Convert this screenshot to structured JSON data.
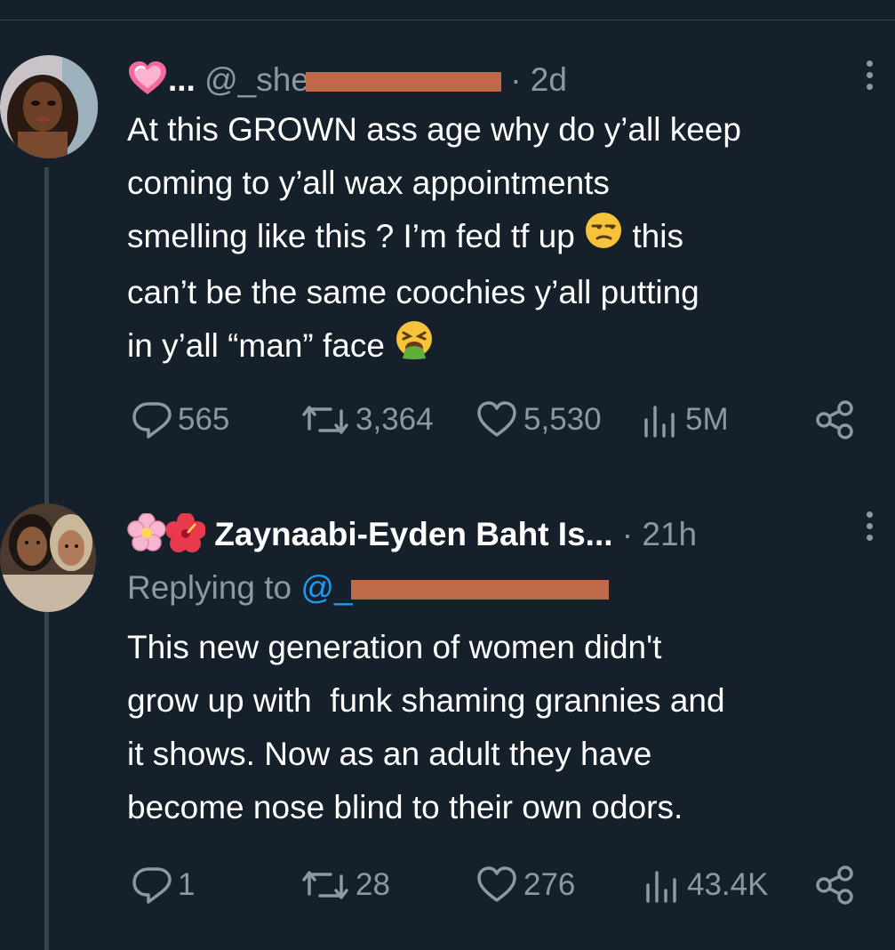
{
  "tweet1": {
    "display_name_suffix": "...",
    "handle": "@_she",
    "time": "· 2d",
    "text_lines": [
      "At this GROWN ass age why do y’all keep",
      "coming to y’all wax appointments",
      "smelling like this ? I’m fed tf up",
      "can’t be the same coochies y’all putting",
      "in y’all “man” face"
    ],
    "text_line3_tail": "this",
    "emoji_1": "unamused-face",
    "emoji_2": "vomiting-face",
    "name_emoji": "pink-heart",
    "stats": {
      "replies": "565",
      "retweets": "3,364",
      "likes": "5,530",
      "views": "5M"
    }
  },
  "tweet2": {
    "name": "Zaynaabi-Eyden Baht Is...",
    "time": "· 21h",
    "name_emojis": [
      "cherry-blossom",
      "hibiscus"
    ],
    "replying_prefix": "Replying to",
    "replying_handle": "@_",
    "text_lines": [
      "This new generation of women didn't",
      "grow up with  funk shaming grannies and",
      "it shows. Now as an adult they have",
      "become nose blind to their own odors."
    ],
    "stats": {
      "replies": "1",
      "retweets": "28",
      "likes": "276",
      "views": "43.4K"
    }
  },
  "colors": {
    "background": "#15202b",
    "muted": "#8b98a5",
    "link": "#1d9bf0",
    "redaction": "#c0694a"
  }
}
